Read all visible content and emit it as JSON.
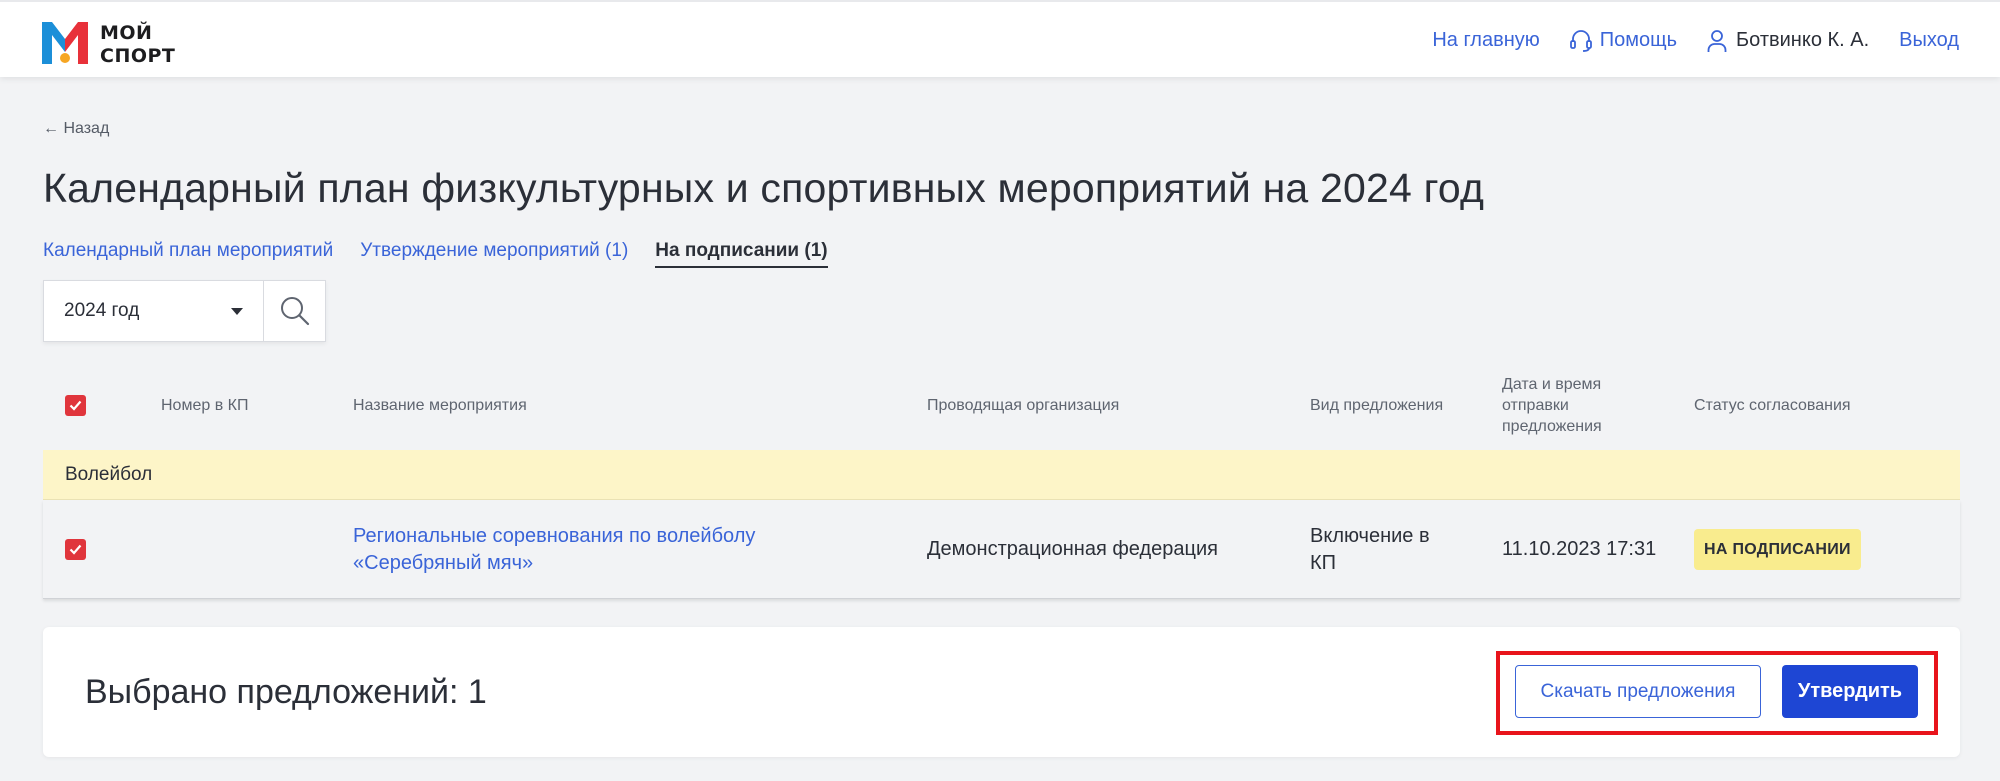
{
  "header": {
    "logo_text_line1": "МОЙ",
    "logo_text_line2": "СПОРТ",
    "nav_home": "На главную",
    "nav_help": "Помощь",
    "user_name": "Ботвинко К. А.",
    "nav_logout": "Выход"
  },
  "back_label": "← Назад",
  "page_title": "Календарный план физкультурных и спортивных мероприятий на 2024 год",
  "tabs": [
    {
      "label": "Календарный план мероприятий",
      "active": false
    },
    {
      "label": "Утверждение мероприятий (1)",
      "active": false
    },
    {
      "label": "На подписании (1)",
      "active": true
    }
  ],
  "filter": {
    "year_selected": "2024 год"
  },
  "table": {
    "columns": {
      "number": "Номер в КП",
      "name": "Название мероприятия",
      "org": "Проводящая организация",
      "type": "Вид предложения",
      "datetime": "Дата и время отправки предложения",
      "status": "Статус согласования"
    },
    "group": "Волейбол",
    "rows": [
      {
        "number": "",
        "name": "Региональные соревнования по волейболу «Серебряный мяч»",
        "org": "Демонстрационная федерация",
        "type": "Включение в КП",
        "datetime": "11.10.2023 17:31",
        "status": "НА ПОДПИСАНИИ",
        "checked": true
      }
    ]
  },
  "footer": {
    "selected_text": "Выбрано предложений: 1",
    "download_label": "Скачать предложения",
    "approve_label": "Утвердить"
  },
  "colors": {
    "accent_blue": "#3a64d8",
    "primary_button": "#1e46d4",
    "checkbox_red": "#e0353c",
    "group_row": "#fdf5c8",
    "status_badge": "#f9ec8e",
    "highlight_border": "#e8141b",
    "logo_blue": "#1c8fd8",
    "logo_red": "#e8313a",
    "logo_orange": "#f6a623"
  },
  "icons": {
    "help": "headset-icon",
    "user": "user-icon",
    "search": "search-icon",
    "caret": "caret-down-icon",
    "check": "check-icon"
  }
}
